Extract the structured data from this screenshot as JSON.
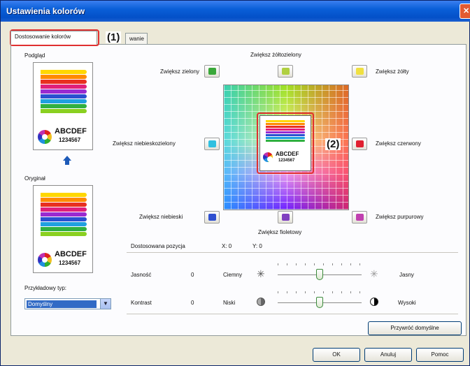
{
  "window": {
    "title": "Ustawienia kolorów",
    "close_glyph": "✕"
  },
  "tabs": [
    {
      "label": "Dostosowanie kolorów",
      "active": true
    },
    {
      "label": "wanie",
      "active": false
    }
  ],
  "callouts": {
    "one": "(1)",
    "two": "(2)"
  },
  "left": {
    "preview_label": "Podgląd",
    "original_label": "Oryginał",
    "sample_text": "ABCDEF",
    "sample_number": "1234567",
    "template_label": "Przykładowy typ:",
    "template_value": "Domyślny"
  },
  "color_buttons": {
    "green": "Zwiększ zielony",
    "yellow_green": "Zwiększ żółtozielony",
    "yellow": "Zwiększ żółty",
    "cyan": "Zwiększ niebieskozielony",
    "red": "Zwiększ czerwony",
    "blue": "Zwiększ niebieski",
    "violet": "Zwiększ fioletowy",
    "purple": "Zwiększ purpurowy"
  },
  "position": {
    "label": "Dostosowana pozycja",
    "x": "X: 0",
    "y": "Y: 0"
  },
  "brightness": {
    "label": "Jasność",
    "value": "0",
    "low": "Ciemny",
    "high": "Jasny",
    "level": 0.5
  },
  "contrast": {
    "label": "Kontrast",
    "value": "0",
    "low": "Niski",
    "high": "Wysoki",
    "level": 0.5
  },
  "buttons": {
    "restore": "Przywróć domyślne",
    "ok": "OK",
    "cancel": "Anuluj",
    "help": "Pomoc"
  },
  "colors": {
    "highlight": "#e03030",
    "titlebar": "#0350c8"
  }
}
